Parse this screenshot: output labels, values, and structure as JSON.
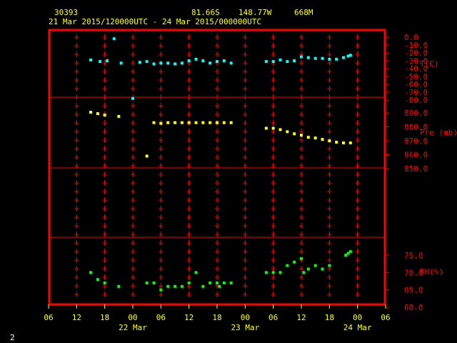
{
  "header": {
    "station": "30393",
    "lat": "81.66S",
    "lon": "148.77W",
    "elev": "668M",
    "period": "21 Mar 2015/120000UTC - 24 Mar 2015/000000UTC"
  },
  "corner_label": "2",
  "colors": {
    "frame": "#ff0000",
    "temperature": "#00ffff",
    "pressure": "#ffff00",
    "rh": "#00ff00",
    "axis_text": "#ffff00",
    "scale_text": "#ff0000"
  },
  "chart_data": [
    {
      "type": "scatter",
      "name": "temperature",
      "ylabel": "T(C)",
      "ylim": [
        -80,
        0
      ],
      "yticks": [
        "0.0",
        "-10.0",
        "-20.0",
        "-30.0",
        "-40.0",
        "-50.0",
        "-60.0",
        "-70.0",
        "-80.0"
      ],
      "x_hours": [
        3,
        5,
        6.5,
        8,
        9.5,
        12,
        13.5,
        15,
        16.5,
        18,
        19.5,
        21,
        22.5,
        24,
        25.5,
        27,
        28.5,
        30,
        31.5,
        33,
        40.5,
        42,
        43.5,
        45,
        46.5,
        48,
        49.5,
        51,
        52.5,
        54,
        55.5,
        57,
        58,
        58.5
      ],
      "values": [
        -29,
        -31,
        -30,
        -2,
        -33,
        -78,
        -32,
        -31,
        -34,
        -33,
        -33,
        -34,
        -33,
        -30,
        -28,
        -30,
        -33,
        -31,
        -30,
        -33,
        -31,
        -31,
        -29,
        -31,
        -30,
        -25,
        -26,
        -27,
        -27,
        -28,
        -28,
        -26,
        -24,
        -23
      ]
    },
    {
      "type": "scatter",
      "name": "pressure",
      "ylabel": "Pre (mb)",
      "ylim": [
        850,
        895
      ],
      "yticks": [
        "890.0",
        "880.0",
        "870.0",
        "860.0",
        "850.0"
      ],
      "x_hours": [
        3,
        4.5,
        6,
        9,
        15,
        16.5,
        18,
        19.5,
        21,
        22.5,
        24,
        25.5,
        27,
        28.5,
        30,
        31.5,
        33,
        40.5,
        42,
        43.5,
        45,
        46.5,
        48,
        49.5,
        51,
        52.5,
        54,
        55.5,
        57,
        58.5
      ],
      "values": [
        890.5,
        889.5,
        888.5,
        887.5,
        859,
        883,
        882.5,
        883,
        883,
        883,
        883,
        883,
        883,
        883,
        883,
        883,
        883,
        879,
        879,
        878,
        876.5,
        875,
        874,
        872.5,
        872,
        871,
        870,
        869,
        868.5,
        868.5
      ]
    },
    {
      "type": "scatter",
      "name": "rh",
      "ylabel": "RH(%)",
      "ylim": [
        60,
        77
      ],
      "yticks": [
        "75.0",
        "70.0",
        "65.0",
        "60.0"
      ],
      "x_hours": [
        3,
        4.5,
        6,
        9,
        15,
        16.5,
        18,
        19.5,
        21,
        22.5,
        24,
        25.5,
        27,
        28.5,
        30,
        30.5,
        31.5,
        33,
        40.5,
        42,
        43.5,
        45,
        46.5,
        48,
        48.5,
        49.5,
        51,
        52.5,
        54,
        57.5,
        58,
        58.5
      ],
      "values": [
        70,
        68,
        67,
        66,
        67,
        67,
        65,
        66,
        66,
        66,
        67,
        70,
        66,
        67,
        67,
        66,
        67,
        67,
        70,
        70,
        70,
        72,
        73,
        74,
        70,
        71,
        72,
        71,
        72,
        75,
        75.5,
        76
      ]
    }
  ],
  "x_axis": {
    "hours_range": [
      -6,
      66
    ],
    "tick_labels": [
      "06",
      "12",
      "18",
      "00",
      "06",
      "12",
      "18",
      "00",
      "06",
      "12",
      "18",
      "00",
      "06"
    ],
    "day_labels": [
      "22 Mar",
      "23 Mar",
      "24 Mar"
    ]
  }
}
